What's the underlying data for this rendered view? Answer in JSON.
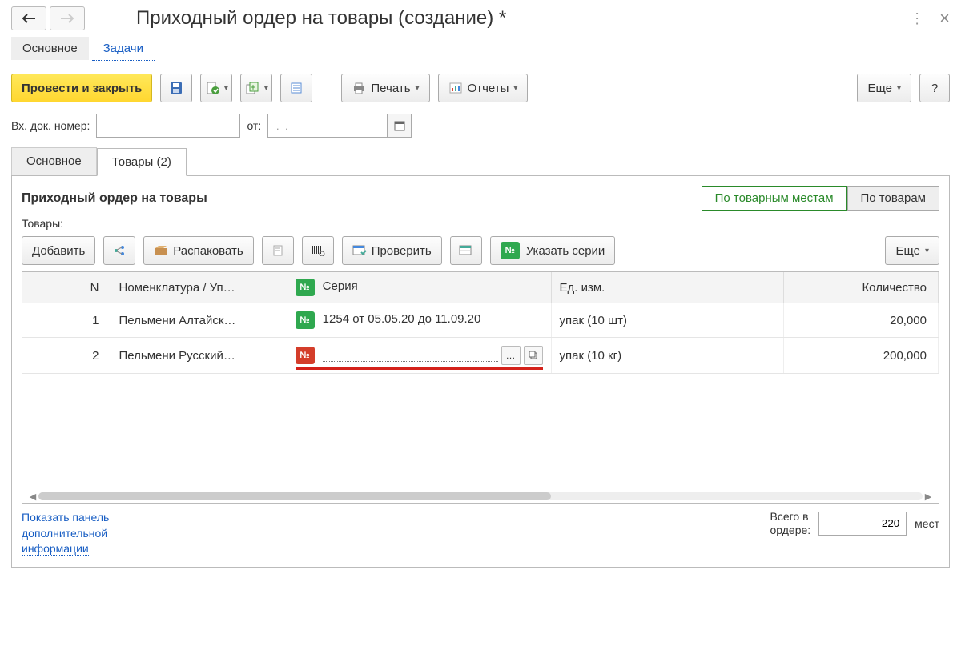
{
  "header": {
    "title": "Приходный ордер на товары (создание) *"
  },
  "navTabs": {
    "main": "Основное",
    "tasks": "Задачи"
  },
  "toolbar": {
    "post_close": "Провести и закрыть",
    "print": "Печать",
    "reports": "Отчеты",
    "more": "Еще",
    "help": "?"
  },
  "doc": {
    "num_label": "Вх. док. номер:",
    "num_value": "",
    "from_label": "от:",
    "date_value": " .  ."
  },
  "tabs2": {
    "main": "Основное",
    "goods": "Товары (2)"
  },
  "panel": {
    "title": "Приходный ордер на товары",
    "seg_places": "По товарным местам",
    "seg_goods": "По товарам",
    "sub_label": "Товары:",
    "add": "Добавить",
    "unpack": "Распаковать",
    "check": "Проверить",
    "series": "Указать серии",
    "more": "Еще"
  },
  "table": {
    "headers": {
      "n": "N",
      "nom": "Номенклатура / Уп…",
      "ser": "Серия",
      "ed": "Ед. изм.",
      "q": "Количество"
    },
    "rows": [
      {
        "n": "1",
        "nom": "Пельмени Алтайск…",
        "series_badge": "green",
        "series": "1254 от 05.05.20 до 11.09.20",
        "unit": "упак (10 шт)",
        "qty": "20,000",
        "editing": false
      },
      {
        "n": "2",
        "nom": "Пельмени Русский…",
        "series_badge": "red",
        "series": "",
        "unit": "упак (10 кг)",
        "qty": "200,000",
        "editing": true
      }
    ],
    "badge_text": "№"
  },
  "footer": {
    "link": "Показать панель дополнительной информации",
    "total_label1": "Всего в",
    "total_label2": "ордере:",
    "total_value": "220",
    "total_unit": "мест"
  }
}
